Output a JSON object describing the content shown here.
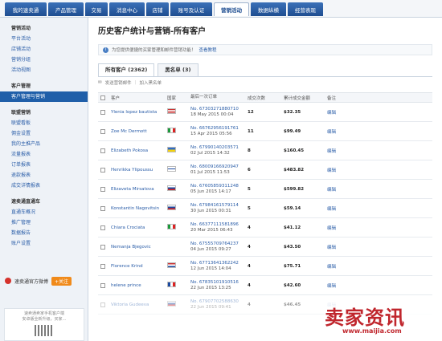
{
  "topnav": [
    "我的速卖通",
    "产品管理",
    "交易",
    "消息中心",
    "店铺",
    "账号及认证",
    "营销活动",
    "数据纵横",
    "经营表现"
  ],
  "topnav_active": 6,
  "sidebar": {
    "s1": {
      "title": "营销活动",
      "items": [
        "平台活动",
        "店铺活动",
        "营销分组",
        "活动视图"
      ]
    },
    "s2": {
      "title": "客户管理",
      "items": [
        "客户管理与营销"
      ]
    },
    "s3": {
      "title": "联盟营销",
      "items": [
        "联盟看板",
        "佣金设置",
        "我的主推产品",
        "流量报表",
        "订单报表",
        "退款报表",
        "成交详情报表"
      ]
    },
    "s4": {
      "title": "速卖通直通车",
      "items": [
        "直通车概况",
        "推广管理",
        "数据报告",
        "账户设置"
      ]
    }
  },
  "official": {
    "label": "速卖通官方微博",
    "follow": "+关注"
  },
  "qr": {
    "line1": "速卖通卖家手机客户端",
    "line2": "安卓版全新升级，买家…"
  },
  "page": {
    "title": "历史客户统计与营销-所有客户",
    "notice": "为您提供便捷的买家管理和邮件营销功能！",
    "notice_link": "查看教程",
    "tabs": [
      "所有客户 (2362)",
      "黑名单 (3)"
    ],
    "actions": {
      "send": "发送营销邮件",
      "blacklist": "加入黑名单"
    },
    "columns": [
      "客户",
      "国家",
      "最后一次订单",
      "成交次数",
      "累计成交金额",
      "备注"
    ]
  },
  "rows": [
    {
      "name": "Ylenia lopez bautista",
      "flag": "us",
      "order": "No. 67303271880710",
      "date": "18 May 2015 00:04",
      "count": "12",
      "amount": "$32.35",
      "remark": "编辑"
    },
    {
      "name": "Zoe Mc Dermott",
      "flag": "it",
      "order": "No. 66762956191761",
      "date": "15 Apr 2015 05:56",
      "count": "11",
      "amount": "$99.49",
      "remark": "编辑"
    },
    {
      "name": "Elizabeth Pokosa",
      "flag": "ua",
      "order": "No. 67990140203571",
      "date": "02 Jul 2015 14:32",
      "count": "8",
      "amount": "$160.45",
      "remark": "编辑"
    },
    {
      "name": "Henrikka Ylipoussu",
      "flag": "fi",
      "order": "No. 68009166920947",
      "date": "01 Jul 2015 11:53",
      "count": "6",
      "amount": "$483.82",
      "remark": "编辑"
    },
    {
      "name": "Elizaveta Mirsatova",
      "flag": "ru",
      "order": "No. 67605859311248",
      "date": "05 Jun 2015 14:17",
      "count": "5",
      "amount": "$599.82",
      "remark": "编辑"
    },
    {
      "name": "Konstantin Nagovitsin",
      "flag": "ru",
      "order": "No. 67984161579114",
      "date": "30 Jun 2015 00:31",
      "count": "5",
      "amount": "$59.14",
      "remark": "编辑"
    },
    {
      "name": "Chiara Crociata",
      "flag": "it",
      "order": "No. 66377111581896",
      "date": "20 Mar 2015 06:43",
      "count": "4",
      "amount": "$41.12",
      "remark": "编辑"
    },
    {
      "name": "Nemanja Bjegovic",
      "flag": "",
      "order": "No. 67555709764237",
      "date": "04 Jun 2015 09:27",
      "count": "4",
      "amount": "$43.50",
      "remark": "编辑"
    },
    {
      "name": "Florence Krind",
      "flag": "nl",
      "order": "No. 67713641362242",
      "date": "12 Jun 2015 14:04",
      "count": "4",
      "amount": "$75.71",
      "remark": "编辑"
    },
    {
      "name": "helene prince",
      "flag": "fr",
      "order": "No. 67835101910516",
      "date": "22 Jun 2015 13:25",
      "count": "4",
      "amount": "$42.60",
      "remark": "编辑"
    },
    {
      "name": "Viktoria Gudeeva",
      "flag": "sk",
      "order": "No. 67907702588630",
      "date": "22 Jun 2015 09:41",
      "count": "4",
      "amount": "$46.45",
      "remark": "编辑"
    }
  ],
  "watermark": {
    "brand": "卖家资讯",
    "url": "www.maijia.com"
  }
}
